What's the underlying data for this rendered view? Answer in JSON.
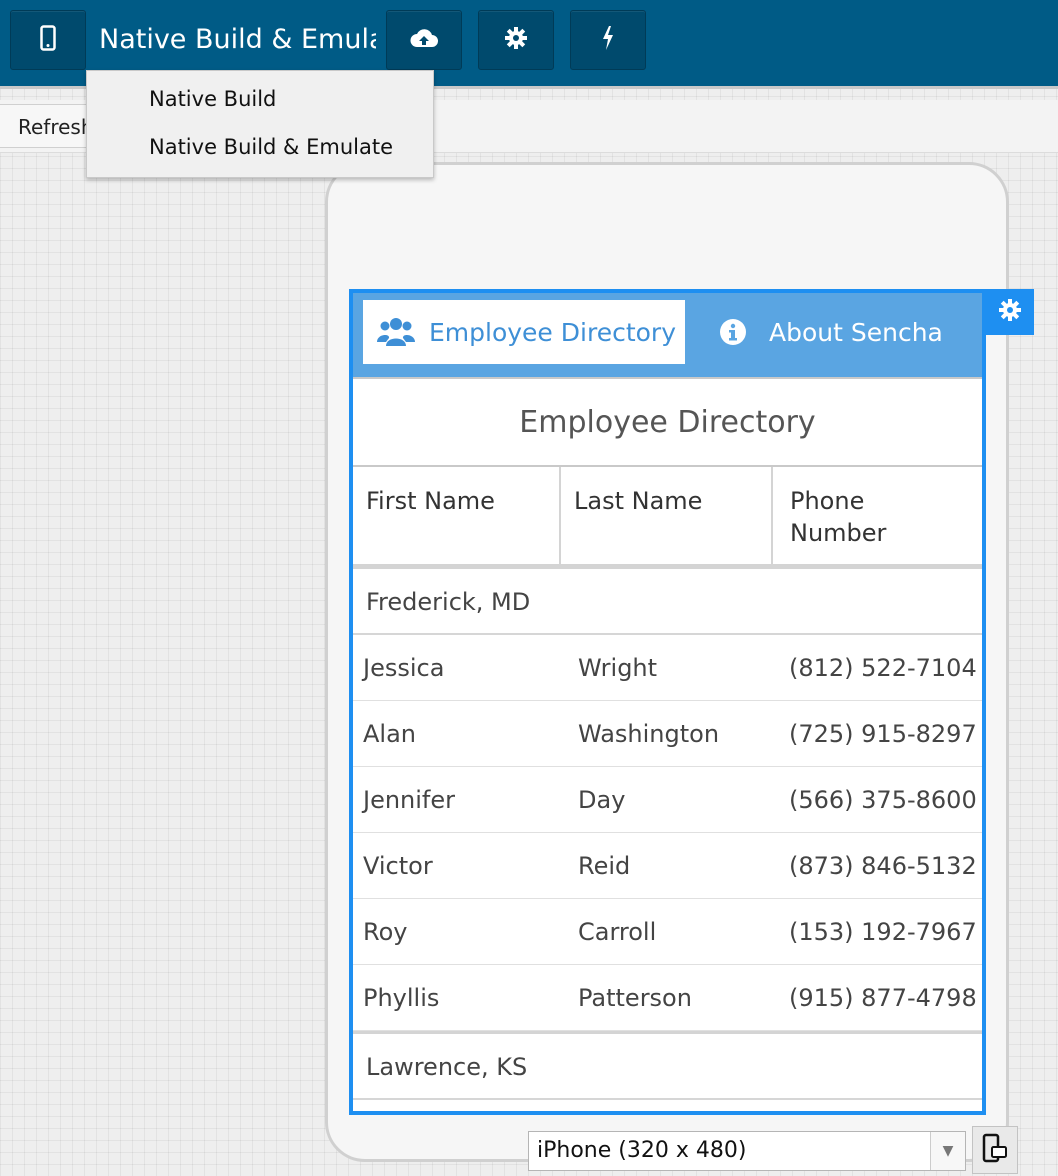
{
  "toolbar": {
    "build_button_label": "Native Build & Emulate",
    "menu_items": [
      "Native Build",
      "Native Build & Emulate"
    ],
    "icons": [
      "mobile-phone-icon",
      "cloud-upload-icon",
      "gear-icon",
      "lightning-bolt-icon"
    ]
  },
  "subbar": {
    "refresh_label": "Refresh"
  },
  "app": {
    "tabs": [
      {
        "label": "Employee Directory",
        "icon": "users-icon",
        "active": true
      },
      {
        "label": "About Sencha",
        "icon": "info-circle-icon",
        "active": false
      }
    ],
    "title": "Employee Directory",
    "columns": [
      "First Name",
      "Last Name",
      "Phone Number"
    ],
    "groups": [
      {
        "name": "Frederick, MD",
        "rows": [
          [
            "Jessica",
            "Wright",
            "(812) 522-7104"
          ],
          [
            "Alan",
            "Washington",
            "(725) 915-8297"
          ],
          [
            "Jennifer",
            "Day",
            "(566) 375-8600"
          ],
          [
            "Victor",
            "Reid",
            "(873) 846-5132"
          ],
          [
            "Roy",
            "Carroll",
            "(153) 192-7967"
          ],
          [
            "Phyllis",
            "Patterson",
            "(915) 877-4798"
          ]
        ]
      },
      {
        "name": "Lawrence, KS",
        "rows": []
      }
    ]
  },
  "footer": {
    "device_selected": "iPhone (320 x 480)"
  },
  "colors": {
    "toolbar": "#005b86",
    "accent": "#1e8ff1",
    "tabbar": "#5aa5e2",
    "active_tab_text": "#3e8fd6"
  }
}
